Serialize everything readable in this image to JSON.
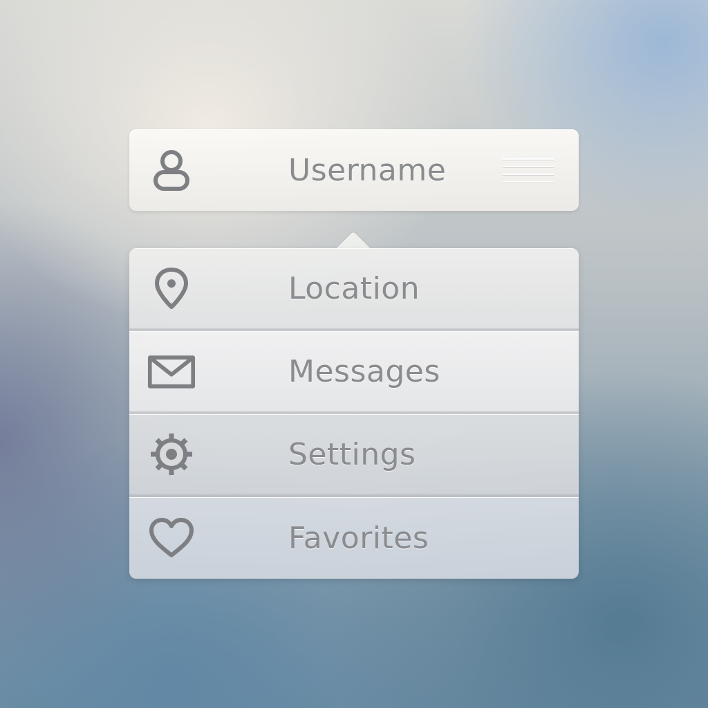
{
  "user": {
    "label": "Username",
    "icon": "user-icon"
  },
  "menu": {
    "items": [
      {
        "label": "Location",
        "icon": "location-pin-icon"
      },
      {
        "label": "Messages",
        "icon": "envelope-icon"
      },
      {
        "label": "Settings",
        "icon": "gear-icon"
      },
      {
        "label": "Favorites",
        "icon": "heart-icon"
      }
    ]
  },
  "colors": {
    "text": "#8a8c8f",
    "icon": "#7d7f82",
    "panel": "#f3f2ef"
  }
}
